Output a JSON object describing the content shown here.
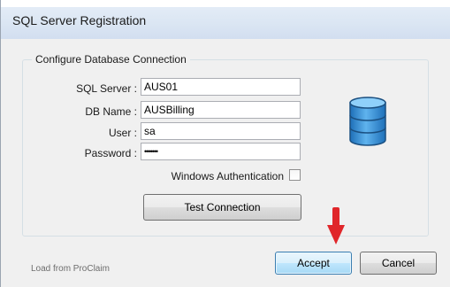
{
  "window": {
    "title": "SQL Server Registration"
  },
  "group": {
    "legend": "Configure Database Connection"
  },
  "form": {
    "sql_server": {
      "label": "SQL Server :",
      "value": "AUS01"
    },
    "db_name": {
      "label": "DB Name :",
      "value": "AUSBilling"
    },
    "user": {
      "label": "User :",
      "value": "sa"
    },
    "password": {
      "label": "Password :",
      "value": "•••••••"
    },
    "windows_auth": {
      "label": "Windows Authentication",
      "checked": false
    }
  },
  "buttons": {
    "test_connection": "Test Connection",
    "accept": "Accept",
    "cancel": "Cancel"
  },
  "footer": {
    "load_text": "Load from ProClaim"
  },
  "icons": {
    "database": "database-icon",
    "annotation": "red-arrow-icon"
  },
  "colors": {
    "annotation_arrow": "#e0262a",
    "database_icon": "#2f8fd8"
  }
}
